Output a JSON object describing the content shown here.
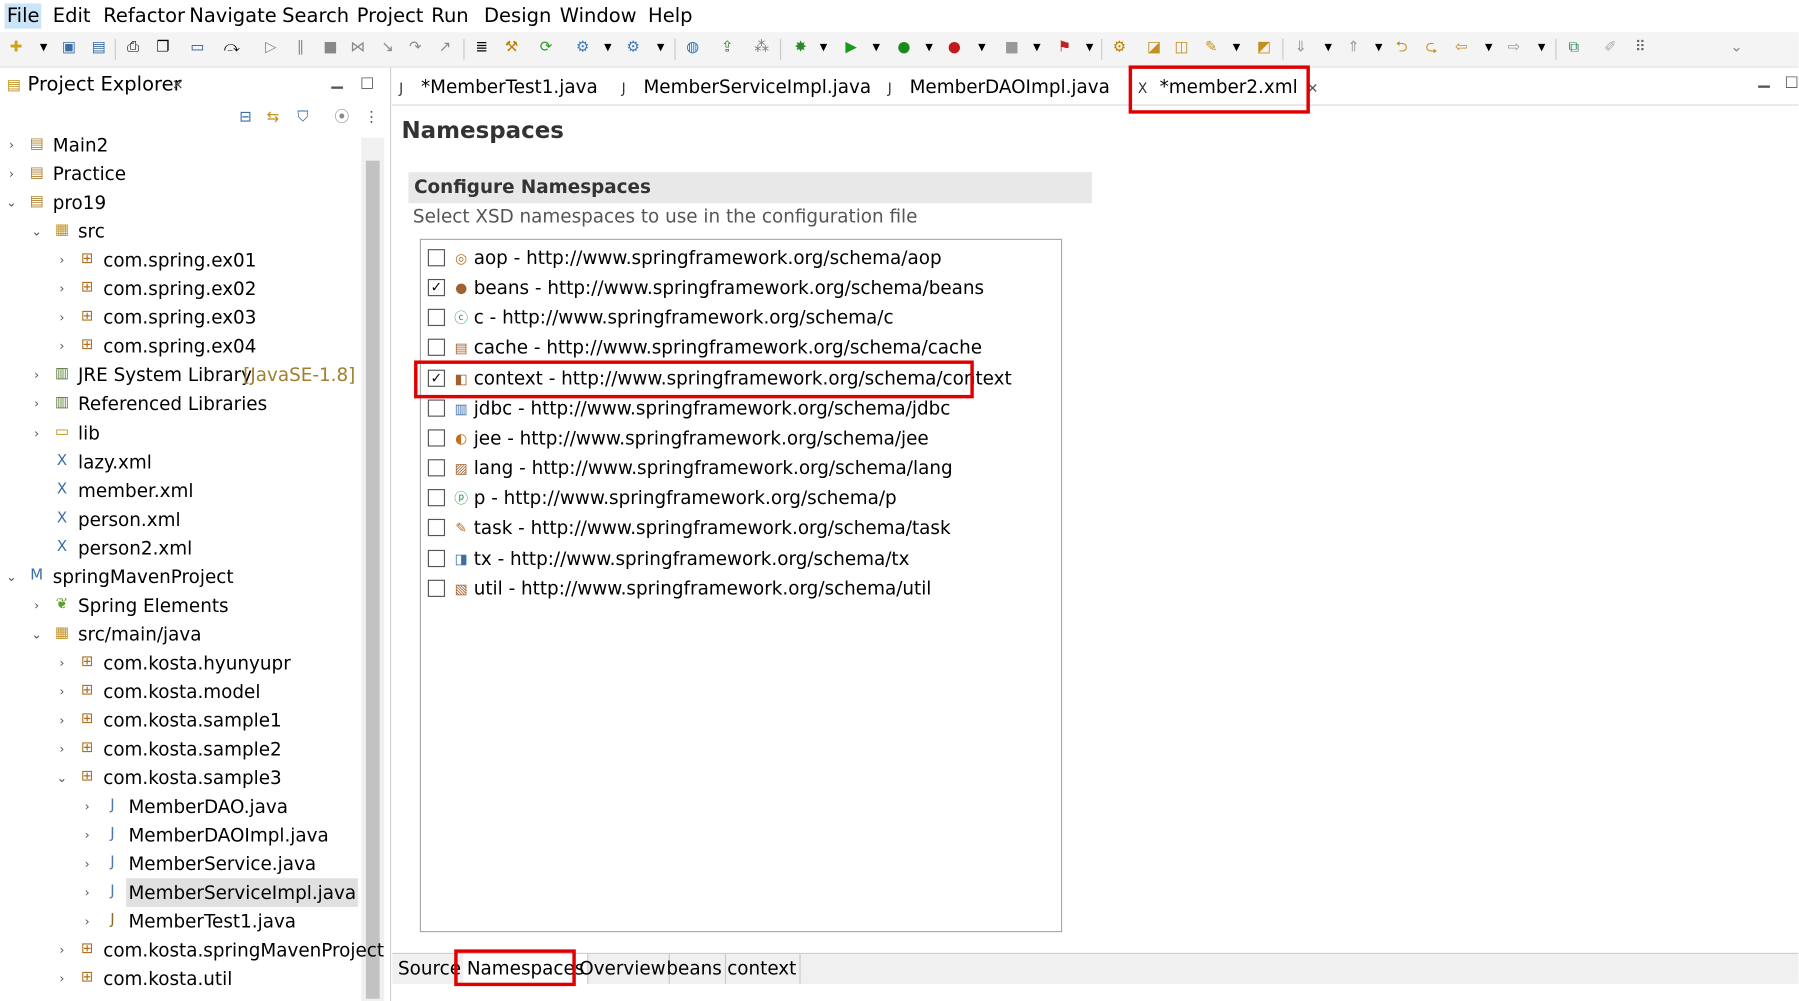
{
  "menu": [
    "File",
    "Edit",
    "Refactor",
    "Navigate",
    "Search",
    "Project",
    "Run",
    "Design",
    "Window",
    "Help"
  ],
  "project_explorer": {
    "title": "Project Explorer",
    "tree": [
      {
        "label": "Main2",
        "icon": "project-icon"
      },
      {
        "label": "Practice",
        "icon": "project-icon"
      },
      {
        "label": "pro19",
        "icon": "project-icon"
      },
      {
        "label": "src",
        "icon": "source-folder-icon"
      },
      {
        "label": "com.spring.ex01",
        "icon": "package-icon"
      },
      {
        "label": "com.spring.ex02",
        "icon": "package-icon"
      },
      {
        "label": "com.spring.ex03",
        "icon": "package-icon"
      },
      {
        "label": "com.spring.ex04",
        "icon": "package-icon"
      },
      {
        "label": "JRE System Library",
        "suffix": "[JavaSE-1.8]",
        "icon": "library-icon"
      },
      {
        "label": "Referenced Libraries",
        "icon": "library-icon"
      },
      {
        "label": "lib",
        "icon": "folder-icon"
      },
      {
        "label": "lazy.xml",
        "icon": "xml-file-icon"
      },
      {
        "label": "member.xml",
        "icon": "xml-file-icon"
      },
      {
        "label": "person.xml",
        "icon": "xml-file-icon"
      },
      {
        "label": "person2.xml",
        "icon": "xml-file-icon"
      },
      {
        "label": "springMavenProject",
        "icon": "maven-project-icon"
      },
      {
        "label": "Spring Elements",
        "icon": "spring-leaf-icon"
      },
      {
        "label": "src/main/java",
        "icon": "source-folder-icon"
      },
      {
        "label": "com.kosta.hyunyupr",
        "icon": "package-icon"
      },
      {
        "label": "com.kosta.model",
        "icon": "package-icon"
      },
      {
        "label": "com.kosta.sample1",
        "icon": "package-icon"
      },
      {
        "label": "com.kosta.sample2",
        "icon": "package-icon"
      },
      {
        "label": "com.kosta.sample3",
        "icon": "package-icon"
      },
      {
        "label": "MemberDAO.java",
        "icon": "java-interface-icon"
      },
      {
        "label": "MemberDAOImpl.java",
        "icon": "java-class-icon"
      },
      {
        "label": "MemberService.java",
        "icon": "java-interface-icon"
      },
      {
        "label": "MemberServiceImpl.java",
        "icon": "java-class-icon"
      },
      {
        "label": "MemberTest1.java",
        "icon": "java-file-icon"
      },
      {
        "label": "com.kosta.springMavenProject",
        "icon": "package-icon"
      },
      {
        "label": "com.kosta.util",
        "icon": "package-icon"
      }
    ]
  },
  "editor_tabs": [
    {
      "label": "*MemberTest1.java",
      "icon": "java-file-icon"
    },
    {
      "label": "MemberServiceImpl.java",
      "icon": "java-file-icon"
    },
    {
      "label": "MemberDAOImpl.java",
      "icon": "java-file-icon"
    },
    {
      "label": "*member2.xml",
      "icon": "spring-xml-icon",
      "active": true
    }
  ],
  "editor": {
    "page_title": "Namespaces",
    "section_title": "Configure Namespaces",
    "section_desc": "Select XSD namespaces to use in the configuration file",
    "namespaces": [
      {
        "label": "aop - http://www.springframework.org/schema/aop",
        "checked": false,
        "icon": "aop-icon"
      },
      {
        "label": "beans - http://www.springframework.org/schema/beans",
        "checked": true,
        "icon": "beans-icon"
      },
      {
        "label": "c - http://www.springframework.org/schema/c",
        "checked": false,
        "icon": "c-namespace-icon"
      },
      {
        "label": "cache - http://www.springframework.org/schema/cache",
        "checked": false,
        "icon": "cache-icon"
      },
      {
        "label": "context - http://www.springframework.org/schema/context",
        "checked": true,
        "icon": "context-icon"
      },
      {
        "label": "jdbc - http://www.springframework.org/schema/jdbc",
        "checked": false,
        "icon": "jdbc-icon"
      },
      {
        "label": "jee - http://www.springframework.org/schema/jee",
        "checked": false,
        "icon": "jee-icon"
      },
      {
        "label": "lang - http://www.springframework.org/schema/lang",
        "checked": false,
        "icon": "lang-icon"
      },
      {
        "label": "p - http://www.springframework.org/schema/p",
        "checked": false,
        "icon": "p-namespace-icon"
      },
      {
        "label": "task - http://www.springframework.org/schema/task",
        "checked": false,
        "icon": "task-icon"
      },
      {
        "label": "tx - http://www.springframework.org/schema/tx",
        "checked": false,
        "icon": "tx-icon"
      },
      {
        "label": "util - http://www.springframework.org/schema/util",
        "checked": false,
        "icon": "util-icon"
      }
    ],
    "bottom_tabs": [
      "Source",
      "Namespaces",
      "Overview",
      "beans",
      "context"
    ],
    "active_bottom_tab": "Namespaces"
  },
  "colors": {
    "highlight": "#e00000",
    "selection": "#e0e0e0",
    "menu_active": "#cce4f7"
  }
}
